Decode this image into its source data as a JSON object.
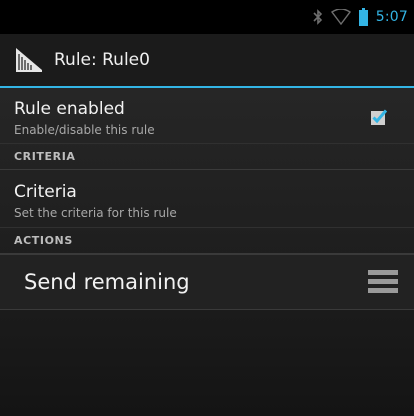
{
  "status_bar": {
    "time": "5:07",
    "icons": [
      "bluetooth-icon",
      "wifi-icon",
      "battery-icon"
    ]
  },
  "action_bar": {
    "title": "Rule: Rule0",
    "icon": "app-logo-icon"
  },
  "preferences": {
    "rule_enabled": {
      "title": "Rule enabled",
      "summary": "Enable/disable this rule",
      "checked": true
    },
    "criteria_category": "CRITERIA",
    "criteria": {
      "title": "Criteria",
      "summary": "Set the criteria for this rule"
    },
    "actions_category": "ACTIONS",
    "actions": [
      {
        "label": "Send remaining",
        "handle_icon": "drag-handle-icon"
      }
    ]
  },
  "colors": {
    "accent": "#33b5e5",
    "background": "#1d1d1d",
    "text_primary": "#f2f2f2",
    "text_secondary": "#a8a8a8"
  }
}
